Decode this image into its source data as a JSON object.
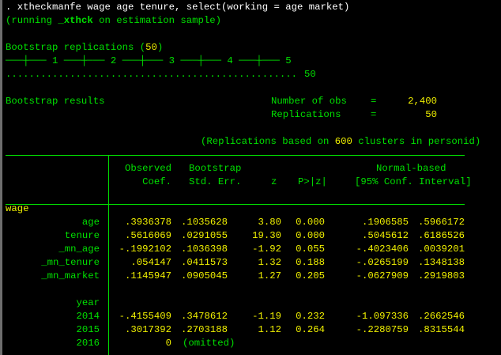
{
  "command": ". xtheckmanfe wage age tenure, select(working = age market)",
  "running_note": {
    "pre": "(running ",
    "cmd": "_xthck",
    "post": " on estimation sample)"
  },
  "bootstrap": {
    "title_pre": "Bootstrap replications (",
    "reps": "50",
    "title_post": ")",
    "ruler": "───┼─── 1 ───┼─── 2 ───┼─── 3 ───┼─── 4 ───┼─── 5",
    "dots": "..................................................",
    "dots_count": "50"
  },
  "results": {
    "title": "Bootstrap results",
    "nobs_label": "Number of obs",
    "nobs_eq": "=",
    "nobs_value": "2,400",
    "reps_label": "Replications",
    "reps_eq": "=",
    "reps_value": "50",
    "cluster_pre": "(Replications based on ",
    "cluster_n": "600",
    "cluster_post": " clusters in personid)"
  },
  "table": {
    "headers": {
      "observed": "Observed",
      "coef": "Coef.",
      "bootstrap": "Bootstrap",
      "se": "Std. Err.",
      "z": "z",
      "p": "P>|z|",
      "normal_based": "Normal-based",
      "ci": "[95% Conf. Interval]"
    },
    "equation": "wage",
    "rows": [
      {
        "label": "age",
        "coef": ".3936378",
        "se": ".1035628",
        "z": "3.80",
        "p": "0.000",
        "lo": ".1906585",
        "hi": ".5966172"
      },
      {
        "label": "tenure",
        "coef": ".5616069",
        "se": ".0291055",
        "z": "19.30",
        "p": "0.000",
        "lo": ".5045612",
        "hi": ".6186526"
      },
      {
        "label": "_mn_age",
        "coef": "-.1992102",
        "se": ".1036398",
        "z": "-1.92",
        "p": "0.055",
        "lo": "-.4023406",
        "hi": ".0039201"
      },
      {
        "label": "_mn_tenure",
        "coef": ".054147",
        "se": ".0411573",
        "z": "1.32",
        "p": "0.188",
        "lo": "-.0265199",
        "hi": ".1348138"
      },
      {
        "label": "_mn_market",
        "coef": ".1145947",
        "se": ".0905045",
        "z": "1.27",
        "p": "0.205",
        "lo": "-.0627909",
        "hi": ".2919803"
      }
    ],
    "factor_label": "year",
    "factor_rows": [
      {
        "label": "2014",
        "coef": "-.4155409",
        "se": ".3478612",
        "z": "-1.19",
        "p": "0.232",
        "lo": "-1.097336",
        "hi": ".2662546"
      },
      {
        "label": "2015",
        "coef": ".3017392",
        "se": ".2703188",
        "z": "1.12",
        "p": "0.264",
        "lo": "-.2280759",
        "hi": ".8315544"
      },
      {
        "label": "2016",
        "coef": "0",
        "se": "(omitted)",
        "z": "",
        "p": "",
        "lo": "",
        "hi": ""
      }
    ]
  },
  "colors": {
    "background": "#000000",
    "text": "#00e000",
    "result": "#f0f000",
    "command": "#ffffff"
  }
}
